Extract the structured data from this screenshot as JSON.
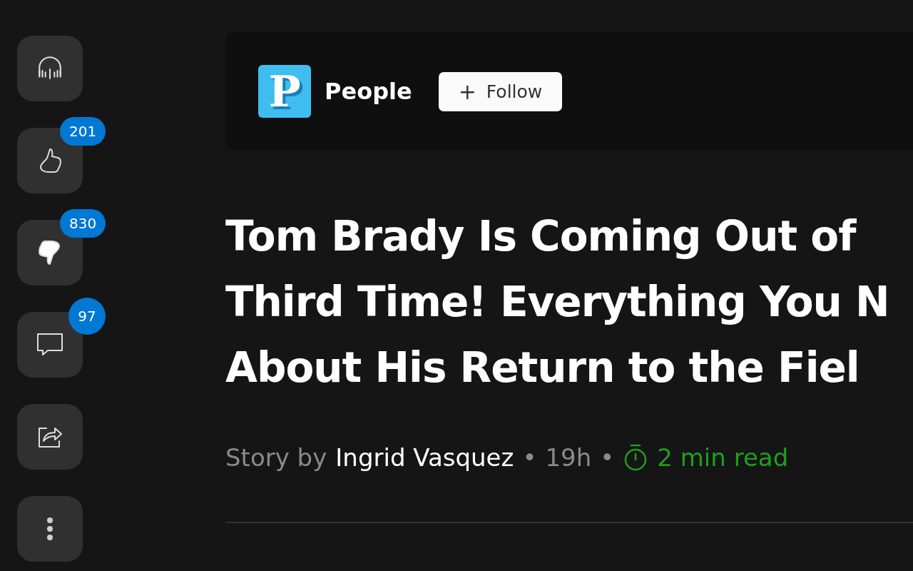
{
  "actions": [
    {
      "kind": "listen"
    },
    {
      "kind": "like",
      "selected": false,
      "count": "201"
    },
    {
      "kind": "dislike",
      "selected": true,
      "count": "830"
    },
    {
      "kind": "comment",
      "selected": false,
      "count": "97"
    },
    {
      "kind": "share"
    },
    {
      "kind": "more"
    }
  ],
  "publisher": {
    "logo_letter": "P",
    "name": "People",
    "follow_button": {
      "icon": "+",
      "label": "Follow"
    }
  },
  "article": {
    "title_lines": [
      "Tom Brady Is Coming Out of",
      "Third Time! Everything You N",
      "About His Return to the Fiel"
    ],
    "byline": {
      "prefix": "Story by",
      "author": "Ingrid Vasquez",
      "separator_1": "•",
      "age": "19h",
      "separator_2": "•",
      "read_time": "2 min read"
    }
  }
}
